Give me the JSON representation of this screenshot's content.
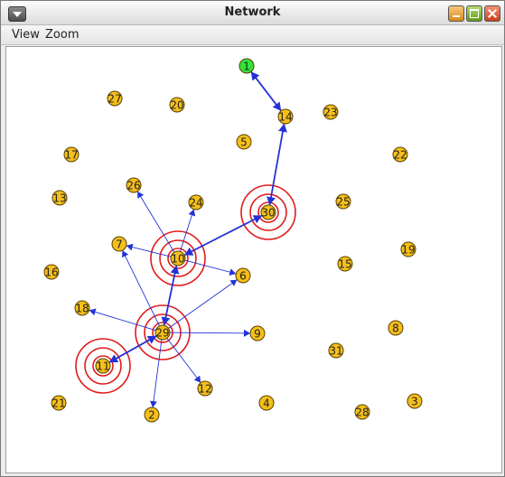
{
  "window": {
    "title": "Network"
  },
  "menus": [
    "View",
    "Zoom"
  ],
  "colors": {
    "node_fill": "#f5bf1a",
    "node_start_fill": "#33e33a",
    "edge": "#2232d6",
    "halo": "#e01b1b",
    "node_stroke": "#5a4000"
  },
  "nodes": [
    {
      "id": "1",
      "start": true
    },
    {
      "id": "14"
    },
    {
      "id": "27"
    },
    {
      "id": "20"
    },
    {
      "id": "23"
    },
    {
      "id": "5"
    },
    {
      "id": "17"
    },
    {
      "id": "22"
    },
    {
      "id": "26"
    },
    {
      "id": "13"
    },
    {
      "id": "24"
    },
    {
      "id": "30",
      "halo": true
    },
    {
      "id": "25"
    },
    {
      "id": "7"
    },
    {
      "id": "10",
      "halo": true
    },
    {
      "id": "19"
    },
    {
      "id": "16"
    },
    {
      "id": "15"
    },
    {
      "id": "6"
    },
    {
      "id": "18"
    },
    {
      "id": "29",
      "halo": true
    },
    {
      "id": "9"
    },
    {
      "id": "8"
    },
    {
      "id": "31"
    },
    {
      "id": "11",
      "halo": true
    },
    {
      "id": "12"
    },
    {
      "id": "21"
    },
    {
      "id": "2"
    },
    {
      "id": "4"
    },
    {
      "id": "28"
    },
    {
      "id": "3"
    }
  ],
  "edges": [
    {
      "from": "1",
      "to": "14",
      "bold": true,
      "both": true
    },
    {
      "from": "14",
      "to": "30",
      "bold": true,
      "both": true
    },
    {
      "from": "30",
      "to": "10",
      "bold": true,
      "both": true
    },
    {
      "from": "10",
      "to": "29",
      "bold": true,
      "both": true
    },
    {
      "from": "29",
      "to": "11",
      "bold": true,
      "both": true
    },
    {
      "from": "10",
      "to": "26"
    },
    {
      "from": "10",
      "to": "24"
    },
    {
      "from": "10",
      "to": "7"
    },
    {
      "from": "10",
      "to": "6"
    },
    {
      "from": "29",
      "to": "7"
    },
    {
      "from": "29",
      "to": "18"
    },
    {
      "from": "29",
      "to": "6"
    },
    {
      "from": "29",
      "to": "9"
    },
    {
      "from": "29",
      "to": "12"
    },
    {
      "from": "29",
      "to": "2"
    }
  ]
}
